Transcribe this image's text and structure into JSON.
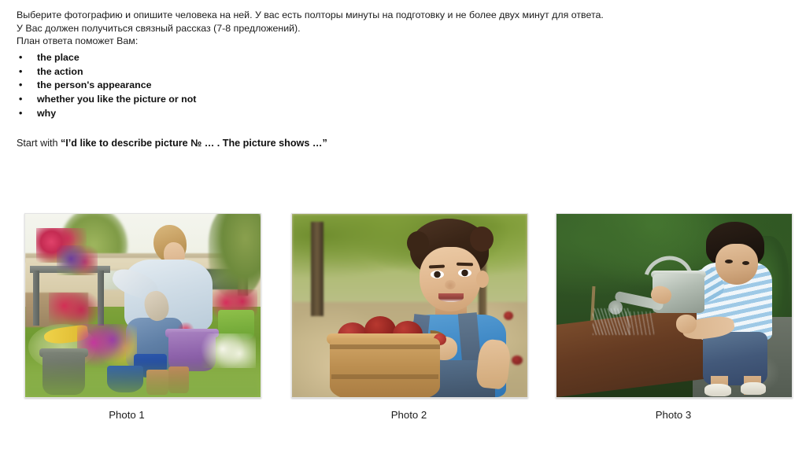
{
  "instructions": {
    "lines": [
      "Выберите фотографию и опишите человека на ней. У вас есть полторы минуты на подготовку и не более двух минут для ответа.",
      "У Вас должен получиться связный рассказ (7-8 предложений).",
      "План ответа поможет Вам:"
    ],
    "plan_items": [
      "the place",
      "the action",
      "the person's appearance",
      "whether you like the picture or not",
      "why"
    ],
    "bullet_glyph": "•",
    "start_prefix": "Start with ",
    "start_quote": "“I’d like to describe picture № … . The picture shows …”"
  },
  "photos": [
    {
      "caption": "Photo 1",
      "alt": "A young woman kneeling on a lawn planting red flowers into a purple pot in a garden, surrounded by blue bowls, terracotta and grey pots, with a house behind her",
      "subject": "woman-gardening"
    },
    {
      "caption": "Photo 2",
      "alt": "A smiling boy in a blue t-shirt and denim overalls holding a wooden bushel basket full of red apples in an orchard",
      "subject": "boy-with-apples"
    },
    {
      "caption": "Photo 3",
      "alt": "A boy in a blue and white striped shirt and denim shorts watering a raised wooden garden bed with a metal watering can",
      "subject": "boy-watering-garden"
    }
  ],
  "colors": {
    "background": "#ffffff",
    "text": "#1b1b1b",
    "bold_text": "#111111",
    "photo_border": "#e3e3e3"
  }
}
